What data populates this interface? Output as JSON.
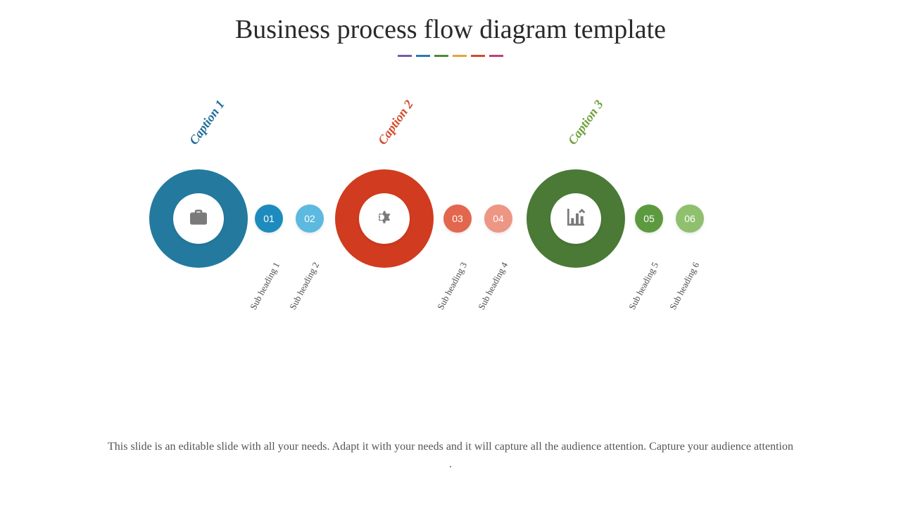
{
  "title": "Business process flow diagram template",
  "divider_colors": [
    "#7b5aa6",
    "#2a7ab0",
    "#4d8a3a",
    "#e8a23c",
    "#d24a2c",
    "#c23e7a"
  ],
  "groups": [
    {
      "caption": "Caption 1",
      "caption_color": "#1f6e99",
      "ring_color": "#237a9e",
      "icon": "briefcase",
      "bubbles": [
        {
          "num": "01",
          "label": "Sub heading 1",
          "color": "#1d8bbd"
        },
        {
          "num": "02",
          "label": "Sub heading 2",
          "color": "#5cb9df"
        }
      ]
    },
    {
      "caption": "Caption 2",
      "caption_color": "#d24a2c",
      "ring_color": "#d13b1f",
      "icon": "gear",
      "bubbles": [
        {
          "num": "03",
          "label": "Sub heading 3",
          "color": "#e2674e"
        },
        {
          "num": "04",
          "label": "Sub heading 4",
          "color": "#ec9683"
        }
      ]
    },
    {
      "caption": "Caption 3",
      "caption_color": "#6fa03b",
      "ring_color": "#4a7a36",
      "icon": "chart",
      "bubbles": [
        {
          "num": "05",
          "label": "Sub heading 5",
          "color": "#5d9a3f"
        },
        {
          "num": "06",
          "label": "Sub heading 6",
          "color": "#8fc06e"
        }
      ]
    }
  ],
  "footer": "This slide is an editable slide with all your needs. Adapt it with your needs and it will capture all the audience attention. Capture your audience attention ."
}
